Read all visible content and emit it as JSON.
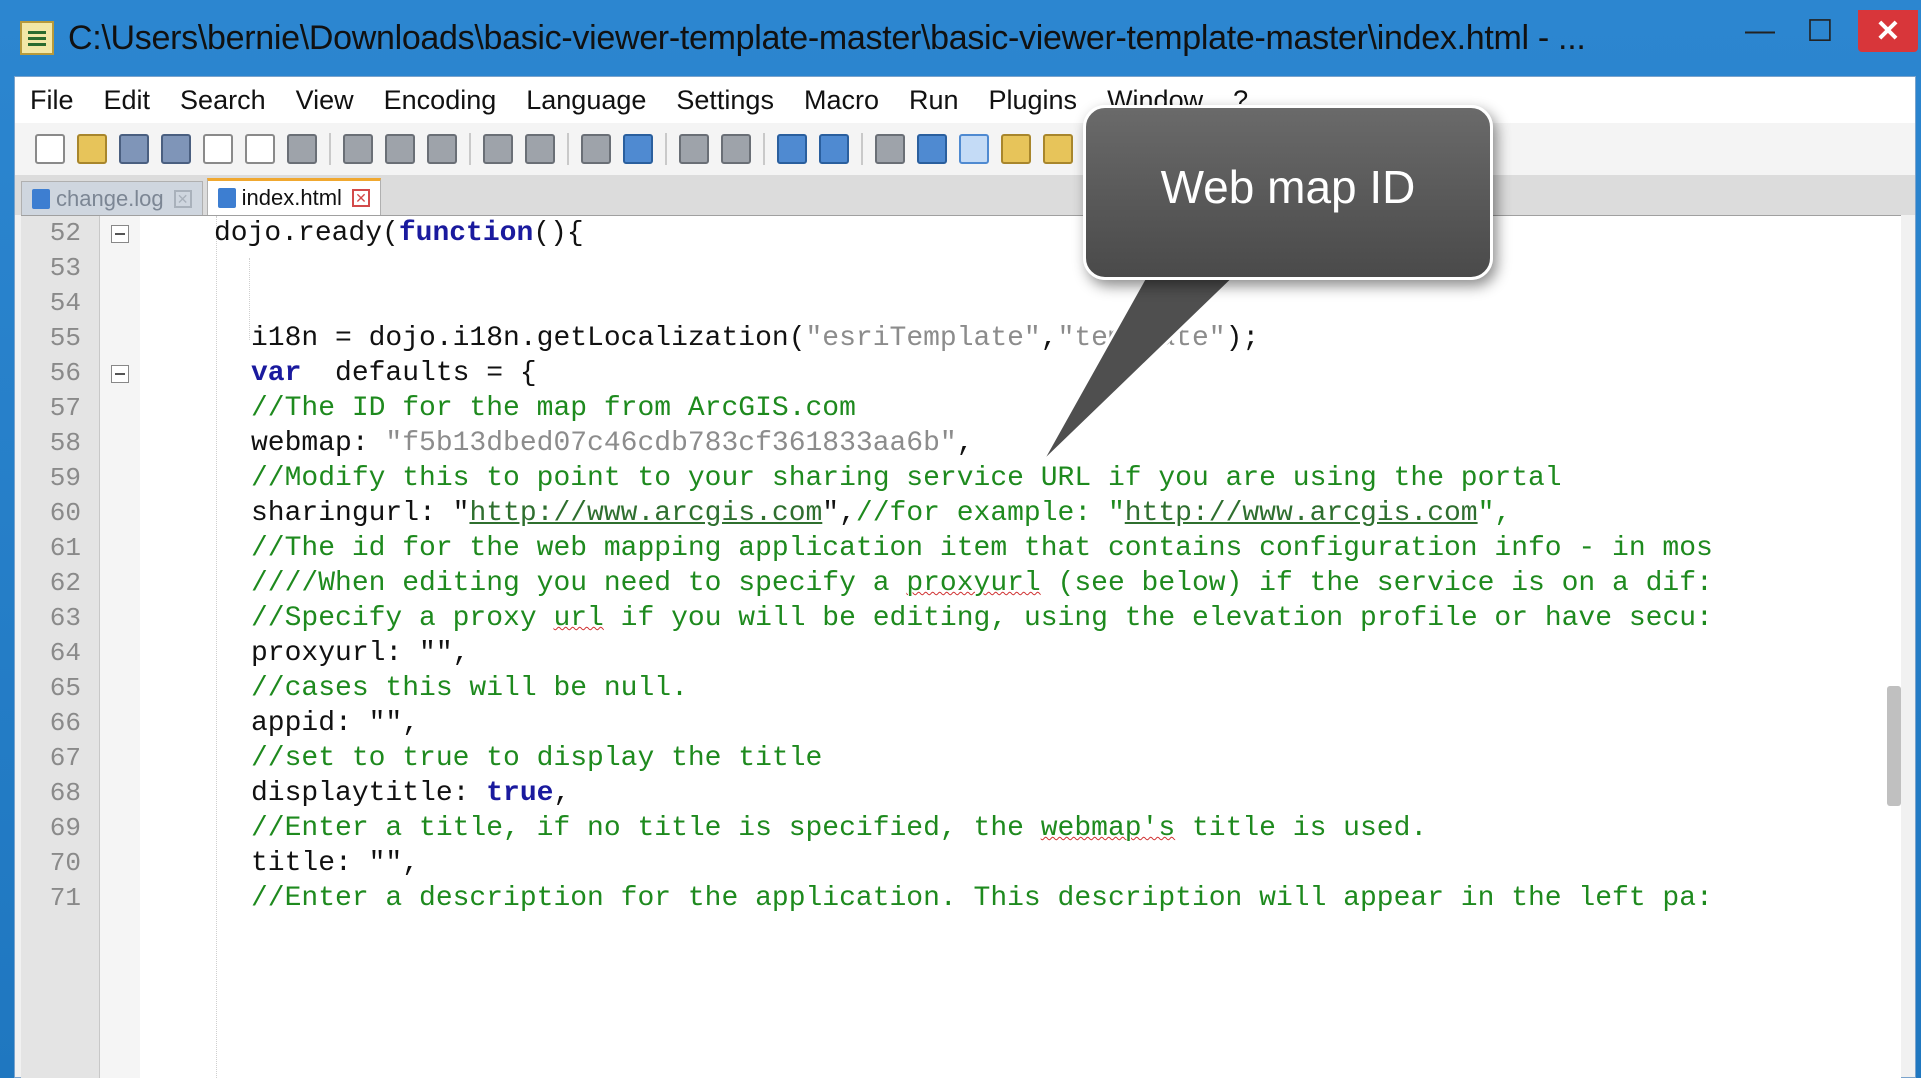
{
  "window": {
    "title": "C:\\Users\\bernie\\Downloads\\basic-viewer-template-master\\basic-viewer-template-master\\index.html - ...",
    "minimize_symbol": "—",
    "maximize_symbol": "☐",
    "close_symbol": "✕"
  },
  "menu": [
    "File",
    "Edit",
    "Search",
    "View",
    "Encoding",
    "Language",
    "Settings",
    "Macro",
    "Run",
    "Plugins",
    "Window",
    "?"
  ],
  "tabs": [
    {
      "label": "change.log",
      "active": false
    },
    {
      "label": "index.html",
      "active": true
    }
  ],
  "tab_close_symbol": "✕",
  "callout": {
    "text": "Web map ID"
  },
  "editor": {
    "lines": [
      {
        "num": "52"
      },
      {
        "num": "53"
      },
      {
        "num": "54"
      },
      {
        "num": "55"
      },
      {
        "num": "56"
      },
      {
        "num": "57"
      },
      {
        "num": "58"
      },
      {
        "num": "59"
      },
      {
        "num": "60"
      },
      {
        "num": "61"
      },
      {
        "num": "62"
      },
      {
        "num": "63"
      },
      {
        "num": "64"
      },
      {
        "num": "65"
      },
      {
        "num": "66"
      },
      {
        "num": "67"
      },
      {
        "num": "68"
      },
      {
        "num": "69"
      },
      {
        "num": "70"
      },
      {
        "num": "71"
      }
    ],
    "code": {
      "l52_a": "dojo.ready(",
      "l52_kw": "function",
      "l52_b": "(){",
      "l55_a": "i18n = dojo.i18n.getLocalization(",
      "l55_s1": "\"esriTemplate\"",
      "l55_comma": ",",
      "l55_s2": "\"template\"",
      "l55_b": ");",
      "l56_kw": "var",
      "l56_a": "  defaults = {",
      "l57": "//The ID for the map from ArcGIS.com",
      "l58_a": "webmap: ",
      "l58_s": "\"f5b13dbed07c46cdb783cf361833aa6b\"",
      "l58_b": ",",
      "l59": "//Modify this to point to your sharing service URL if you are using the portal",
      "l60_a": "sharingurl: \"",
      "l60_url1": "http://www.arcgis.com",
      "l60_b": "\",",
      "l60_cm": "//for example: \"",
      "l60_url2": "http://www.arcgis.com",
      "l60_c": "\",",
      "l61": "//The id for the web mapping application item that contains configuration info - in mos",
      "l62_a": "////When editing you need to specify a ",
      "l62_sq": "proxyurl",
      "l62_b": " (see below) if the service is on a dif:",
      "l63_a": "//Specify a proxy ",
      "l63_sq": "url",
      "l63_b": " if you will be editing, using the elevation profile or have secu:",
      "l64": "proxyurl: \"\",",
      "l65": "//cases this will be null.",
      "l66": "appid: \"\",",
      "l67": "//set to true to display the title",
      "l68_a": "displaytitle: ",
      "l68_kw": "true",
      "l68_b": ",",
      "l69_a": "//Enter a title, if no title is specified, the ",
      "l69_sq": "webmap's",
      "l69_b": " title is used.",
      "l70": "title: \"\",",
      "l71": "//Enter a description for the application. This description will appear in the left pa:"
    }
  }
}
